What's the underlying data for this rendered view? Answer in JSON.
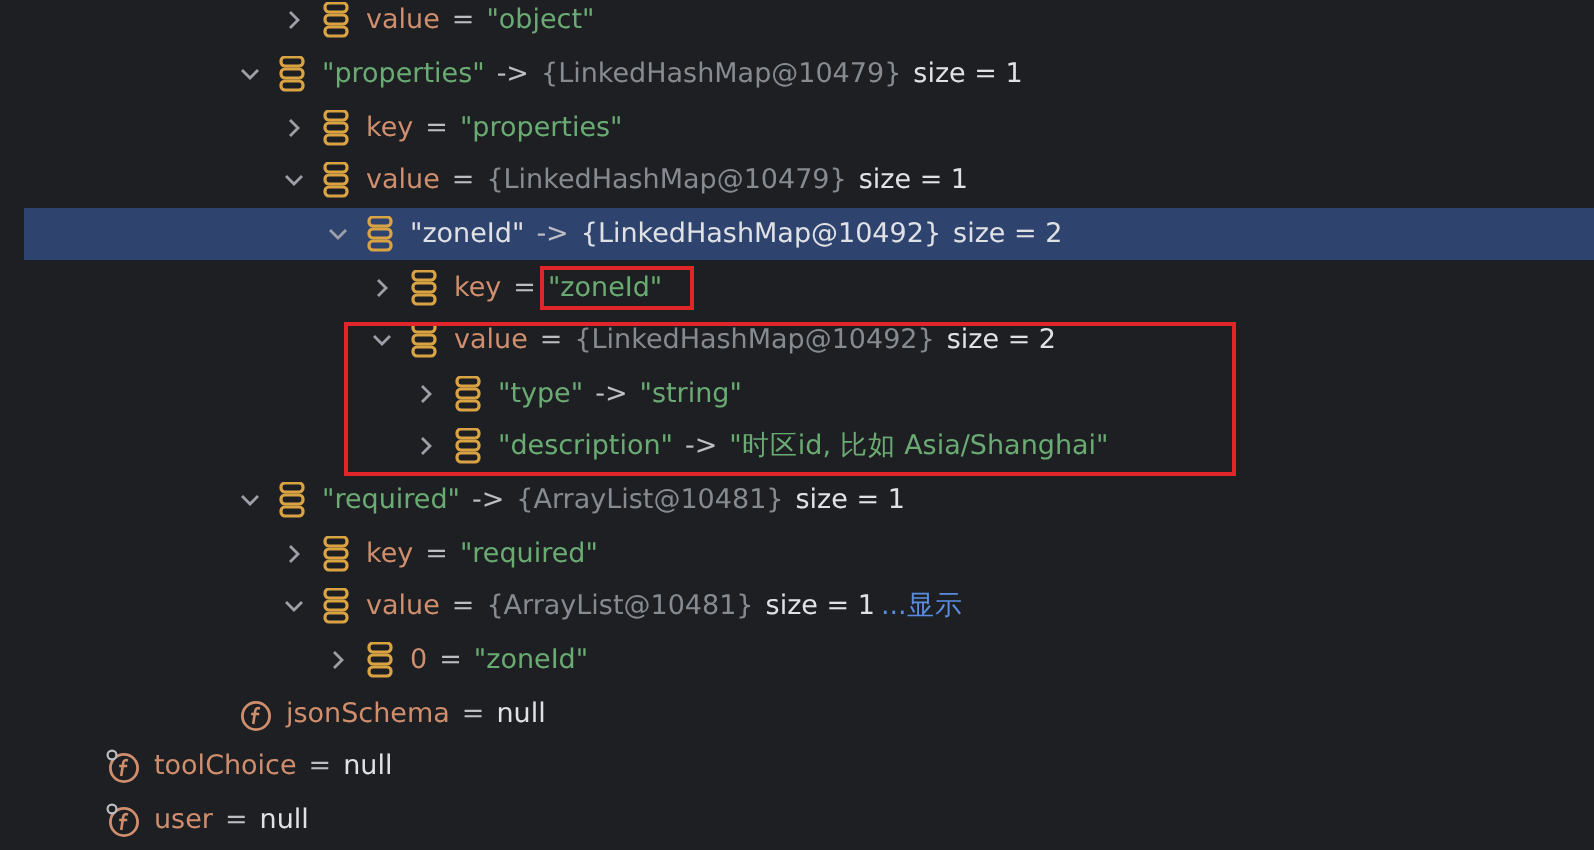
{
  "tree": [
    {
      "children": [
        {
          "children": [
            {
              "children": [
                {
                  "children": [
                    {
                      "kind": "entry",
                      "expanded": false,
                      "selected": false,
                      "highlighted": false,
                      "parts": [
                        {
                          "text": "value",
                          "kind": "name"
                        },
                        {
                          "text": "=",
                          "kind": "op"
                        },
                        {
                          "text": "\"object\"",
                          "kind": "string"
                        }
                      ]
                    }
                  ]
                },
                {
                  "kind": "entry",
                  "expanded": true,
                  "selected": false,
                  "highlighted": false,
                  "parts": [
                    {
                      "text": "\"properties\"",
                      "kind": "string"
                    },
                    {
                      "text": "->",
                      "kind": "op"
                    },
                    {
                      "text": "{LinkedHashMap@10479}",
                      "kind": "ref"
                    },
                    {
                      "text": "size = 1",
                      "kind": "size"
                    }
                  ],
                  "children": [
                    {
                      "kind": "entry",
                      "expanded": false,
                      "selected": false,
                      "highlighted": false,
                      "parts": [
                        {
                          "text": "key",
                          "kind": "name"
                        },
                        {
                          "text": "=",
                          "kind": "op"
                        },
                        {
                          "text": "\"properties\"",
                          "kind": "string"
                        }
                      ]
                    },
                    {
                      "kind": "entry",
                      "expanded": true,
                      "selected": false,
                      "highlighted": false,
                      "parts": [
                        {
                          "text": "value",
                          "kind": "name"
                        },
                        {
                          "text": "=",
                          "kind": "op"
                        },
                        {
                          "text": "{LinkedHashMap@10479}",
                          "kind": "ref"
                        },
                        {
                          "text": "size = 1",
                          "kind": "size"
                        }
                      ],
                      "children": [
                        {
                          "kind": "entry",
                          "expanded": true,
                          "selected": true,
                          "highlighted": false,
                          "parts": [
                            {
                              "text": "\"zoneId\"",
                              "kind": "string_selected"
                            },
                            {
                              "text": "->",
                              "kind": "op"
                            },
                            {
                              "text": "{LinkedHashMap@10492}",
                              "kind": "ref_selected"
                            },
                            {
                              "text": "size = 2",
                              "kind": "size"
                            }
                          ],
                          "children": [
                            {
                              "kind": "entry",
                              "expanded": false,
                              "selected": false,
                              "highlighted": false,
                              "parts": [
                                {
                                  "text": "key",
                                  "kind": "name"
                                },
                                {
                                  "text": "=",
                                  "kind": "op"
                                },
                                {
                                  "text": "\"zoneId\"",
                                  "kind": "string_boxed"
                                }
                              ]
                            },
                            {
                              "kind": "entry",
                              "expanded": true,
                              "selected": false,
                              "highlighted": true,
                              "parts": [
                                {
                                  "text": "value",
                                  "kind": "name"
                                },
                                {
                                  "text": "=",
                                  "kind": "op"
                                },
                                {
                                  "text": "{LinkedHashMap@10492}",
                                  "kind": "ref"
                                },
                                {
                                  "text": "size = 2",
                                  "kind": "size"
                                }
                              ],
                              "children": [
                                {
                                  "kind": "entry",
                                  "expanded": false,
                                  "selected": false,
                                  "highlighted": false,
                                  "parts": [
                                    {
                                      "text": "\"type\"",
                                      "kind": "string"
                                    },
                                    {
                                      "text": "->",
                                      "kind": "op"
                                    },
                                    {
                                      "text": "\"string\"",
                                      "kind": "string"
                                    }
                                  ]
                                },
                                {
                                  "kind": "entry",
                                  "expanded": false,
                                  "selected": false,
                                  "highlighted": false,
                                  "parts": [
                                    {
                                      "text": "\"description\"",
                                      "kind": "string"
                                    },
                                    {
                                      "text": "->",
                                      "kind": "op"
                                    },
                                    {
                                      "text": "\"时区id, 比如 Asia/Shanghai\"",
                                      "kind": "string"
                                    }
                                  ]
                                }
                              ]
                            }
                          ]
                        }
                      ]
                    }
                  ]
                },
                {
                  "kind": "entry",
                  "expanded": true,
                  "selected": false,
                  "highlighted": false,
                  "parts": [
                    {
                      "text": "\"required\"",
                      "kind": "string"
                    },
                    {
                      "text": "->",
                      "kind": "op"
                    },
                    {
                      "text": "{ArrayList@10481}",
                      "kind": "ref"
                    },
                    {
                      "text": "size = 1",
                      "kind": "size"
                    }
                  ],
                  "children": [
                    {
                      "kind": "entry",
                      "expanded": false,
                      "selected": false,
                      "highlighted": false,
                      "parts": [
                        {
                          "text": "key",
                          "kind": "name"
                        },
                        {
                          "text": "=",
                          "kind": "op"
                        },
                        {
                          "text": "\"required\"",
                          "kind": "string"
                        }
                      ]
                    },
                    {
                      "kind": "entry",
                      "expanded": true,
                      "selected": false,
                      "highlighted": false,
                      "parts": [
                        {
                          "text": "value",
                          "kind": "name"
                        },
                        {
                          "text": "=",
                          "kind": "op"
                        },
                        {
                          "text": "{ArrayList@10481}",
                          "kind": "ref"
                        },
                        {
                          "text": "size = 1",
                          "kind": "size"
                        },
                        {
                          "text": "...显示",
                          "kind": "link"
                        }
                      ],
                      "children": [
                        {
                          "kind": "entry",
                          "expanded": false,
                          "selected": false,
                          "highlighted": false,
                          "parts": [
                            {
                              "text": "0",
                              "kind": "name"
                            },
                            {
                              "text": "=",
                              "kind": "op"
                            },
                            {
                              "text": "\"zoneId\"",
                              "kind": "string"
                            }
                          ]
                        }
                      ]
                    }
                  ]
                },
                {
                  "kind": "field",
                  "selected": false,
                  "highlighted": false,
                  "parts": [
                    {
                      "text": "jsonSchema",
                      "kind": "name"
                    },
                    {
                      "text": "=",
                      "kind": "op"
                    },
                    {
                      "text": "null",
                      "kind": "null"
                    }
                  ]
                }
              ]
            }
          ]
        }
      ]
    },
    {
      "kind": "field_pinned",
      "selected": false,
      "highlighted": false,
      "parts": [
        {
          "text": "toolChoice",
          "kind": "name"
        },
        {
          "text": "=",
          "kind": "op"
        },
        {
          "text": "null",
          "kind": "null"
        }
      ]
    },
    {
      "kind": "field_pinned",
      "selected": false,
      "highlighted": false,
      "parts": [
        {
          "text": "user",
          "kind": "name"
        },
        {
          "text": "=",
          "kind": "op"
        },
        {
          "text": "null",
          "kind": "null"
        }
      ]
    }
  ]
}
